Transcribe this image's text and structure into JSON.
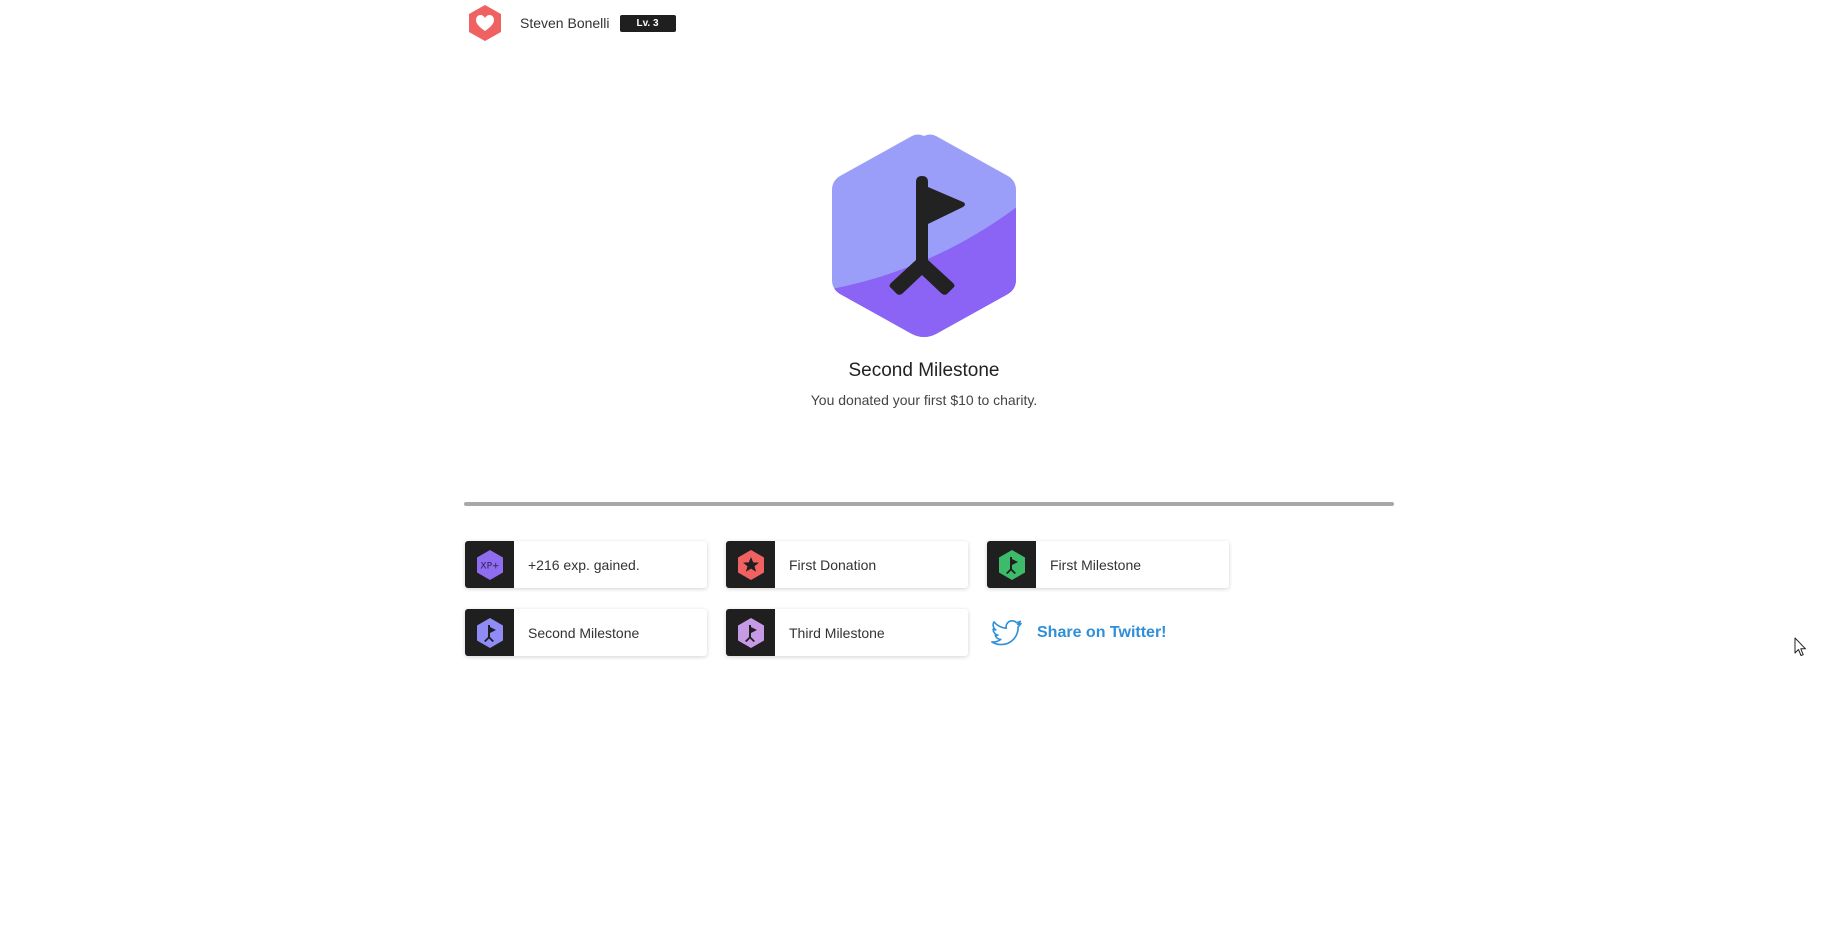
{
  "header": {
    "user_name": "Steven Bonelli",
    "level": "Lv. 3",
    "logo_icon": "heart-hexagon-icon",
    "logo_color": "#f06262"
  },
  "milestone": {
    "title": "Second Milestone",
    "description": "You donated your first $10 to charity.",
    "icon": "flag-icon",
    "colors": {
      "light": "#9b9ef8",
      "dark": "#8b63f5",
      "glyph": "#222222"
    }
  },
  "progress": {
    "fraction": 1.0,
    "color": "#a8a8a8"
  },
  "rewards": [
    {
      "label": "+216 exp. gained.",
      "icon": "xp-plus-icon",
      "color": "#8f6cf0",
      "badge_text": "XP+"
    },
    {
      "label": "First Donation",
      "icon": "star-icon",
      "color": "#f06262"
    },
    {
      "label": "First Milestone",
      "icon": "flag-icon",
      "color": "#3dbb6a"
    },
    {
      "label": "Second Milestone",
      "icon": "flag-icon",
      "color": "#8f8cf5"
    },
    {
      "label": "Third Milestone",
      "icon": "flag-icon",
      "color": "#c79ae6"
    }
  ],
  "share": {
    "label": "Share on Twitter!",
    "icon": "twitter-bird-icon",
    "color": "#2f8fd8"
  }
}
